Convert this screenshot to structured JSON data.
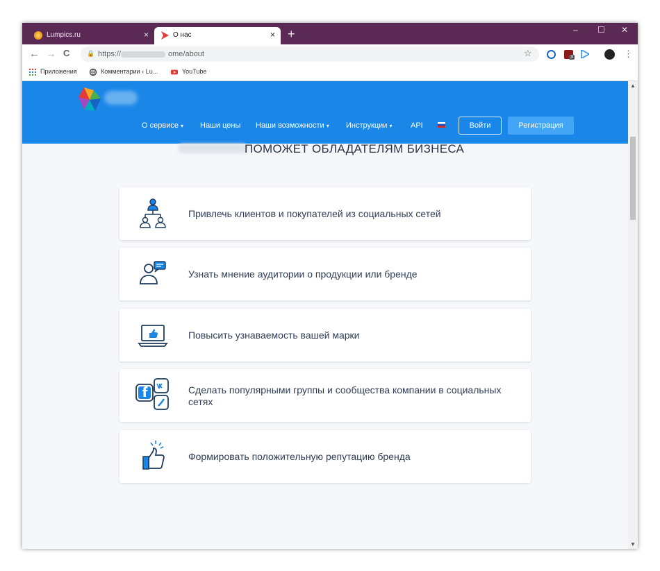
{
  "browser": {
    "tabs": [
      {
        "label": "Lumpics.ru",
        "close": "×"
      },
      {
        "label": "О нас",
        "close": "×"
      }
    ],
    "new_tab": "+",
    "window_controls": {
      "minimize": "–",
      "maximize": "☐",
      "close": "✕"
    },
    "nav": {
      "back": "←",
      "forward": "→",
      "reload": "C"
    },
    "address": {
      "scheme": "https://",
      "path": "ome/about"
    },
    "extension_badge": "3",
    "bookmarks": [
      {
        "label": "Приложения",
        "icon": "apps-grid-icon"
      },
      {
        "label": "Комментарии ‹ Lu...",
        "icon": "globe-icon"
      },
      {
        "label": "YouTube",
        "icon": "youtube-icon"
      }
    ]
  },
  "site": {
    "nav_items": [
      {
        "label": "О сервисе",
        "caret": "▾"
      },
      {
        "label": "Наши цены"
      },
      {
        "label": "Наши возможности",
        "caret": "▾"
      },
      {
        "label": "Инструкции",
        "caret": "▾"
      },
      {
        "label": "API"
      }
    ],
    "login_label": "Войти",
    "register_label": "Регистрация",
    "headline": "ПОМОЖЕТ ОБЛАДАТЕЛЯМ БИЗНЕСА",
    "features": [
      {
        "text": "Привлечь клиентов и покупателей из социальных сетей",
        "icon": "org-chart-icon"
      },
      {
        "text": "Узнать мнение аудитории о продукции или бренде",
        "icon": "user-chat-icon"
      },
      {
        "text": "Повысить узнаваемость вашей марки",
        "icon": "laptop-like-icon"
      },
      {
        "text": "Сделать популярными группы и сообщества компании в социальных сетях",
        "icon": "social-networks-icon"
      },
      {
        "text": "Формировать положительную репутацию бренда",
        "icon": "thumbs-up-icon"
      }
    ]
  },
  "colors": {
    "titlebar": "#5a2a55",
    "header": "#1a86e8",
    "register_button": "#42a5f5",
    "icon_dark": "#1e3a5f",
    "icon_blue": "#1a86e8"
  }
}
